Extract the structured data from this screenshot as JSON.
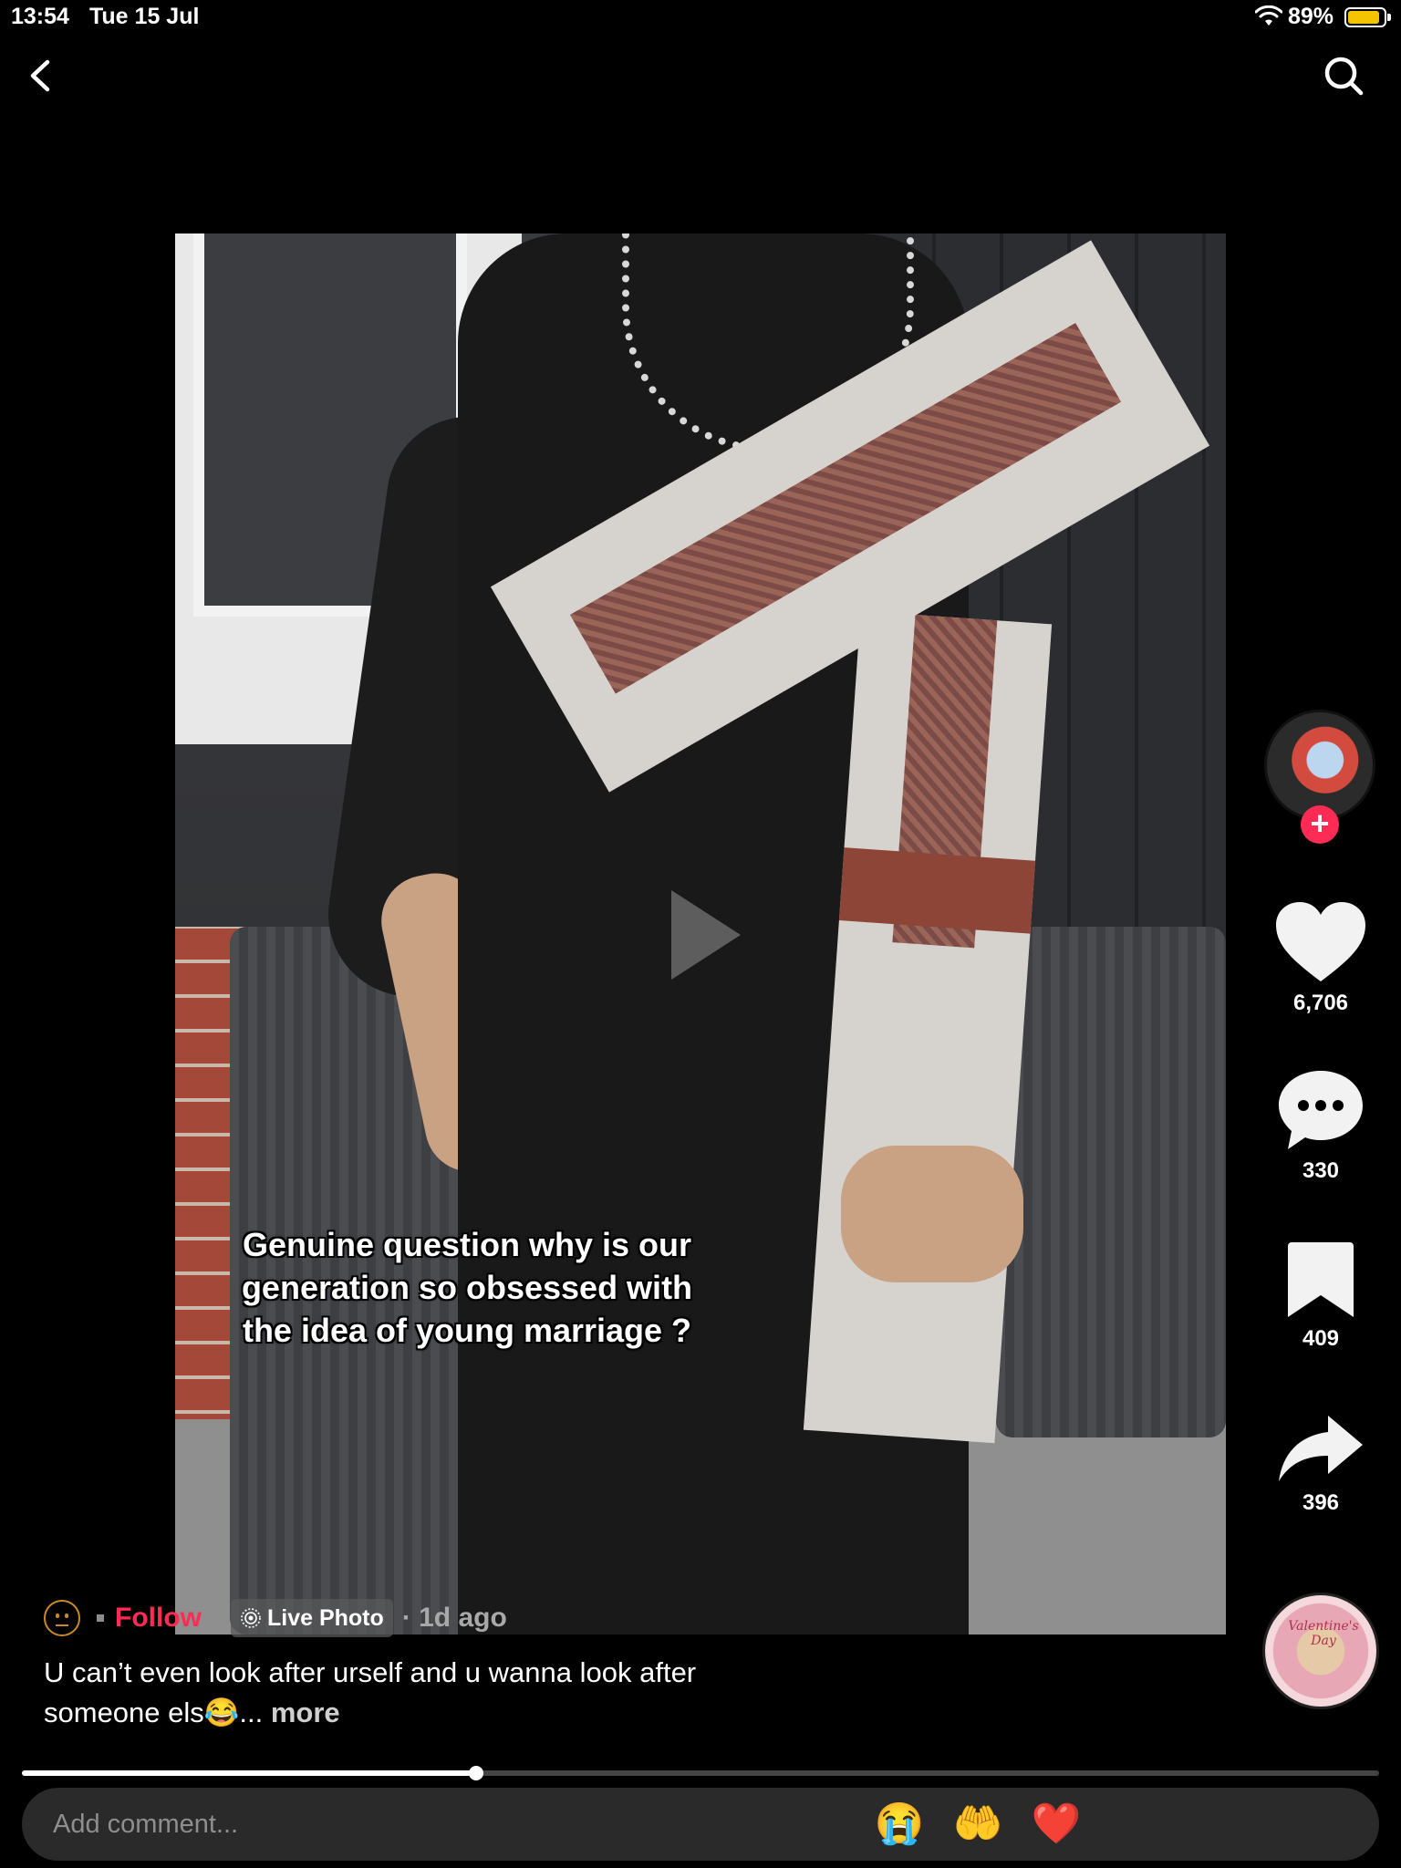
{
  "status_bar": {
    "time": "13:54",
    "date": "Tue 15 Jul",
    "battery_percent": "89%",
    "battery_level": 0.89,
    "battery_color": "#f5c400"
  },
  "nav": {
    "back_icon": "chevron-left-icon",
    "search_icon": "search-icon"
  },
  "video": {
    "caption_lines": [
      "Genuine question why is our",
      "generation so obsessed with",
      "the idea of young marriage ?"
    ],
    "play_icon": "play-icon"
  },
  "actions": {
    "avatar_plus": "+",
    "like_count": "6,706",
    "comment_count": "330",
    "bookmark_count": "409",
    "share_count": "396"
  },
  "post": {
    "follow_label": "Follow",
    "live_photo_label": "Live Photo",
    "posted_time": "· 1d ago",
    "description": "U can’t even look after urself and u wanna look after someone els😂...",
    "more_label": " more",
    "music_disc_text": "Valentine's Day"
  },
  "playback": {
    "progress": 0.335
  },
  "comment": {
    "placeholder": "Add comment...",
    "emojis": [
      "😭",
      "🤲",
      "❤️"
    ]
  },
  "colors": {
    "accent": "#fe2c55",
    "background": "#000000"
  }
}
